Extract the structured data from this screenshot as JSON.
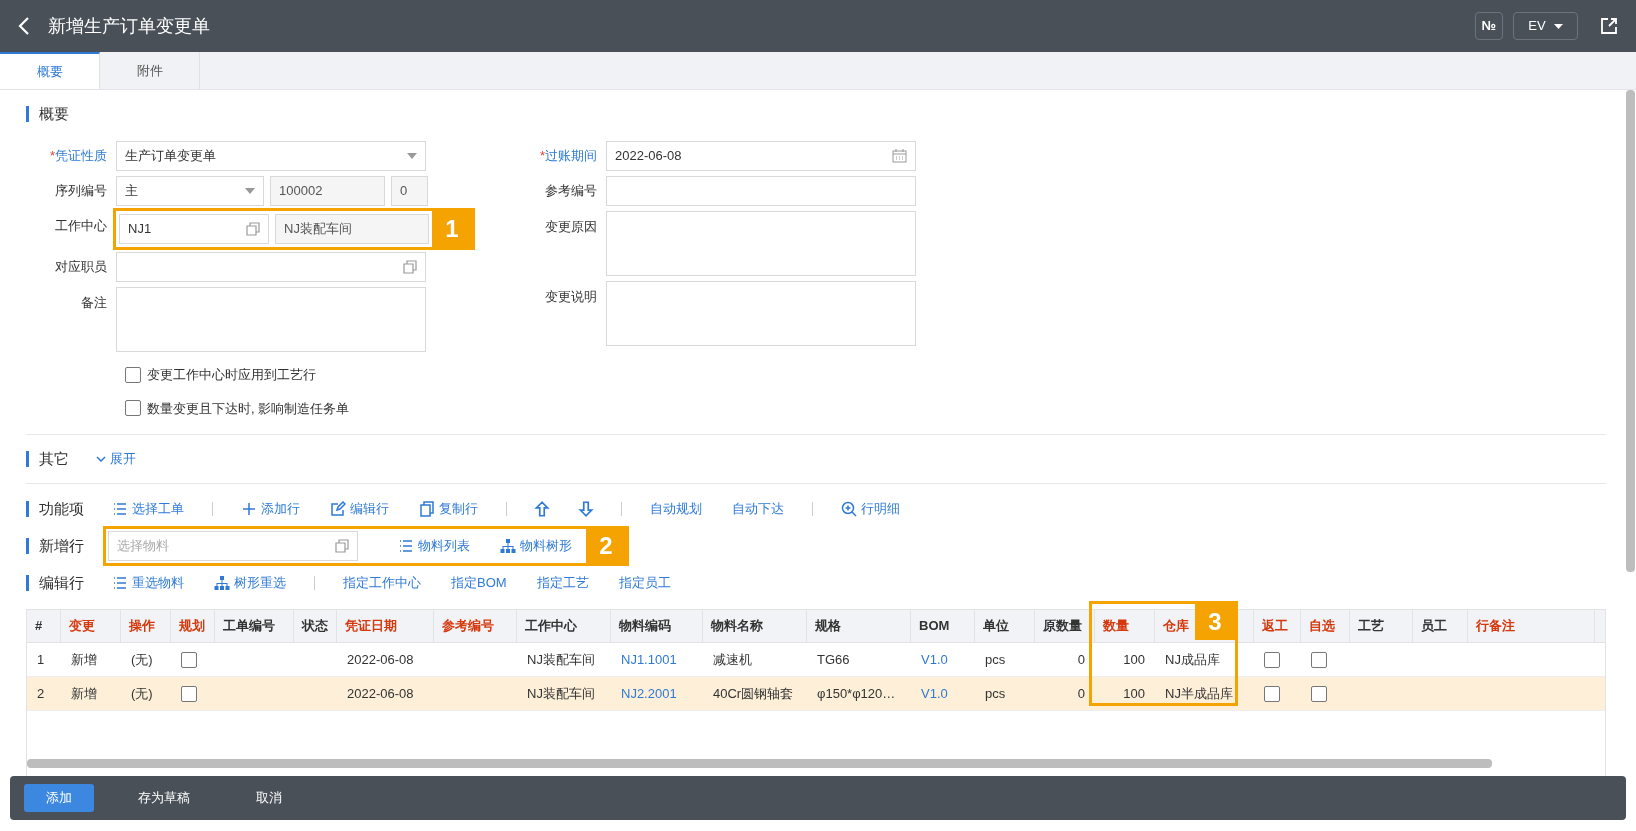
{
  "header": {
    "title": "新增生产订单变更单",
    "number_button": "№",
    "lang_select": "EV"
  },
  "required_mark": "*",
  "tabs": [
    {
      "label": "概要",
      "selected": true
    },
    {
      "label": "附件",
      "selected": false
    }
  ],
  "summary": {
    "title": "概要",
    "left_fields": [
      {
        "label": "凭证性质",
        "required": true,
        "kind": "row",
        "parts": [
          {
            "kind": "select",
            "value": "生产订单变更单"
          }
        ]
      },
      {
        "label": "序列编号",
        "required": false,
        "kind": "row",
        "parts": [
          {
            "kind": "select",
            "value": "主"
          },
          {
            "kind": "readonly",
            "value": "100002"
          },
          {
            "kind": "readonly",
            "value": "0"
          }
        ]
      },
      {
        "label": "工作中心",
        "required": false,
        "kind": "row",
        "callout": "1",
        "parts": [
          {
            "kind": "lookup",
            "value": "NJ1"
          },
          {
            "kind": "readonly",
            "value": "NJ装配车间"
          }
        ]
      },
      {
        "label": "对应职员",
        "required": false,
        "kind": "row",
        "parts": [
          {
            "kind": "lookup"
          }
        ]
      },
      {
        "label": "备注",
        "required": false,
        "kind": "textarea",
        "parts": [
          {
            "kind": "textarea"
          }
        ]
      }
    ],
    "right_fields": [
      {
        "label": "过账期间",
        "required": true,
        "kind": "row",
        "parts": [
          {
            "kind": "date",
            "value": "2022-06-08"
          }
        ]
      },
      {
        "label": "参考编号",
        "required": false,
        "kind": "row",
        "parts": [
          {
            "kind": "text"
          }
        ]
      },
      {
        "label": "变更原因",
        "required": false,
        "kind": "textarea",
        "parts": [
          {
            "kind": "textarea"
          }
        ]
      },
      {
        "label": "变更说明",
        "required": false,
        "kind": "textarea",
        "parts": [
          {
            "kind": "textarea"
          }
        ]
      }
    ],
    "checkboxes": [
      {
        "label": "变更工作中心时应用到工艺行",
        "checked": false
      },
      {
        "label": "数量变更且下达时, 影响制造任务单",
        "checked": false
      }
    ]
  },
  "other": {
    "title": "其它",
    "toggle": "展开"
  },
  "toolbars": [
    {
      "title": "功能项",
      "items": [
        {
          "kind": "list",
          "label": "选择工单"
        },
        {
          "kind": "separator"
        },
        {
          "kind": "plus",
          "label": "添加行"
        },
        {
          "kind": "edit",
          "label": "编辑行"
        },
        {
          "kind": "copy",
          "label": "复制行"
        },
        {
          "kind": "separator"
        },
        {
          "kind": "up"
        },
        {
          "kind": "down"
        },
        {
          "kind": "separator"
        },
        {
          "kind": "text",
          "label": "自动规划"
        },
        {
          "kind": "text",
          "label": "自动下达"
        },
        {
          "kind": "separator"
        },
        {
          "kind": "zoom",
          "label": "行明细"
        }
      ]
    },
    {
      "title": "新增行",
      "callout": "2",
      "items": [
        {
          "kind": "field",
          "placeholder": "选择物料"
        },
        {
          "kind": "list",
          "label": "物料列表"
        },
        {
          "kind": "tree",
          "label": "物料树形"
        }
      ]
    },
    {
      "title": "编辑行",
      "items": [
        {
          "kind": "list",
          "label": "重选物料"
        },
        {
          "kind": "tree",
          "label": "树形重选"
        },
        {
          "kind": "separator"
        },
        {
          "kind": "text",
          "label": "指定工作中心"
        },
        {
          "kind": "text",
          "label": "指定BOM"
        },
        {
          "kind": "text",
          "label": "指定工艺"
        },
        {
          "kind": "text",
          "label": "指定员工"
        }
      ]
    }
  ],
  "table": {
    "callout": "3",
    "columns": [
      {
        "label": "#",
        "required": false
      },
      {
        "label": "变更",
        "required": true
      },
      {
        "label": "操作",
        "required": true
      },
      {
        "label": "规划",
        "required": true
      },
      {
        "label": "工单编号",
        "required": false
      },
      {
        "label": "状态",
        "required": false
      },
      {
        "label": "凭证日期",
        "required": true
      },
      {
        "label": "参考编号",
        "required": true
      },
      {
        "label": "工作中心",
        "required": false
      },
      {
        "label": "物料编码",
        "required": false
      },
      {
        "label": "物料名称",
        "required": false
      },
      {
        "label": "规格",
        "required": false
      },
      {
        "label": "BOM",
        "required": false
      },
      {
        "label": "单位",
        "required": false
      },
      {
        "label": "原数量",
        "required": false
      },
      {
        "label": "数量",
        "required": true
      },
      {
        "label": "仓库",
        "required": true
      },
      {
        "label": "返工",
        "required": true
      },
      {
        "label": "自选",
        "required": true
      },
      {
        "label": "工艺",
        "required": false
      },
      {
        "label": "员工",
        "required": false
      },
      {
        "label": "行备注",
        "required": true
      }
    ],
    "rows": [
      {
        "selected": false,
        "cells": [
          {
            "kind": "text",
            "value": "1"
          },
          {
            "kind": "text",
            "value": "新增"
          },
          {
            "kind": "text",
            "value": "(无)"
          },
          {
            "kind": "checkbox",
            "checked": false
          },
          {
            "kind": "empty"
          },
          {
            "kind": "empty"
          },
          {
            "kind": "text",
            "value": "2022-06-08"
          },
          {
            "kind": "empty"
          },
          {
            "kind": "text",
            "value": "NJ装配车间"
          },
          {
            "kind": "link",
            "value": "NJ1.1001"
          },
          {
            "kind": "text",
            "value": "减速机"
          },
          {
            "kind": "text",
            "value": "TG66"
          },
          {
            "kind": "link",
            "value": "V1.0"
          },
          {
            "kind": "text",
            "value": "pcs"
          },
          {
            "kind": "number",
            "value": "0"
          },
          {
            "kind": "number",
            "value": "100"
          },
          {
            "kind": "text",
            "value": "NJ成品库"
          },
          {
            "kind": "checkbox",
            "checked": false
          },
          {
            "kind": "checkbox",
            "checked": false
          },
          {
            "kind": "empty"
          },
          {
            "kind": "empty"
          },
          {
            "kind": "empty"
          }
        ]
      },
      {
        "selected": true,
        "cells": [
          {
            "kind": "text",
            "value": "2"
          },
          {
            "kind": "text",
            "value": "新增"
          },
          {
            "kind": "text",
            "value": "(无)"
          },
          {
            "kind": "checkbox",
            "checked": false
          },
          {
            "kind": "empty"
          },
          {
            "kind": "empty"
          },
          {
            "kind": "text",
            "value": "2022-06-08"
          },
          {
            "kind": "empty"
          },
          {
            "kind": "text",
            "value": "NJ装配车间"
          },
          {
            "kind": "link",
            "value": "NJ2.2001"
          },
          {
            "kind": "text",
            "value": "40Cr圆钢轴套"
          },
          {
            "kind": "text",
            "value": "φ150*φ120…"
          },
          {
            "kind": "link",
            "value": "V1.0"
          },
          {
            "kind": "text",
            "value": "pcs"
          },
          {
            "kind": "number",
            "value": "0"
          },
          {
            "kind": "number",
            "value": "100"
          },
          {
            "kind": "text",
            "value": "NJ半成品库"
          },
          {
            "kind": "checkbox",
            "checked": false
          },
          {
            "kind": "checkbox",
            "checked": false
          },
          {
            "kind": "empty"
          },
          {
            "kind": "empty"
          },
          {
            "kind": "empty"
          }
        ]
      }
    ]
  },
  "footer": {
    "buttons": [
      {
        "label": "添加",
        "primary": true
      },
      {
        "label": "存为草稿",
        "primary": false
      },
      {
        "label": "取消",
        "primary": false
      }
    ]
  }
}
